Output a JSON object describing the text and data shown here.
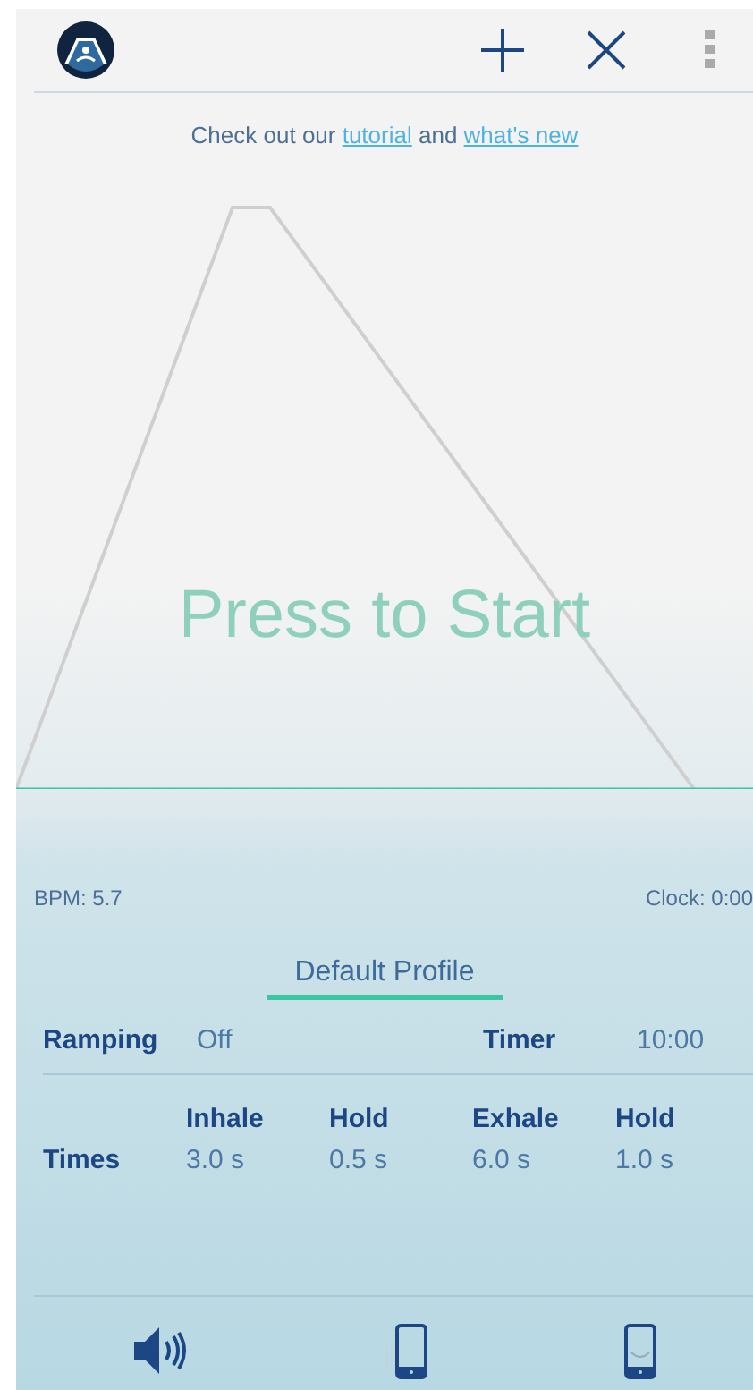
{
  "header": {
    "actions": [
      {
        "kind": "add"
      },
      {
        "kind": "close"
      },
      {
        "kind": "more"
      }
    ]
  },
  "notice": {
    "before": "Check out our ",
    "link1": "tutorial",
    "middle": " and ",
    "link2": "what's new"
  },
  "graph": {
    "prompt": "Press to Start"
  },
  "stats": {
    "bpm": "BPM: 5.7",
    "clock": "Clock: 0:00"
  },
  "profile": {
    "name": "Default Profile"
  },
  "settings": {
    "ramping_label": "Ramping",
    "ramping_value": "Off",
    "timer_label": "Timer",
    "timer_value": "10:00"
  },
  "times": {
    "label": "Times",
    "phases": [
      {
        "name": "Inhale",
        "value": "3.0 s"
      },
      {
        "name": "Hold",
        "value": "0.5 s"
      },
      {
        "name": "Exhale",
        "value": "6.0 s"
      },
      {
        "name": "Hold",
        "value": "1.0 s"
      }
    ]
  },
  "toolbar": [
    {
      "kind": "sound"
    },
    {
      "kind": "vibrate"
    },
    {
      "kind": "screen"
    }
  ]
}
